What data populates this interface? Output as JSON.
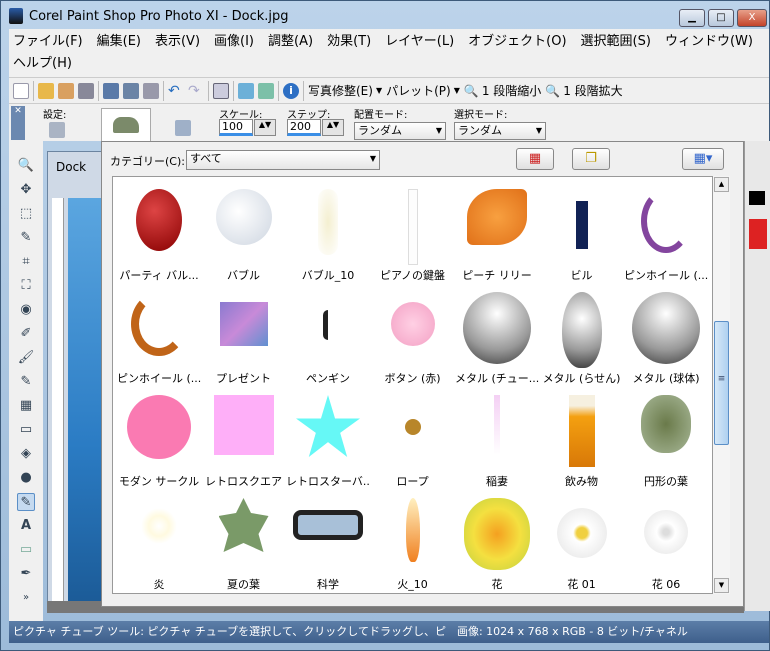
{
  "window": {
    "title": "Corel Paint Shop Pro Photo XI - Dock.jpg",
    "minimize": "▁",
    "maximize": "□",
    "close": "X"
  },
  "menu": [
    "ファイル(F)",
    "編集(E)",
    "表示(V)",
    "画像(I)",
    "調整(A)",
    "効果(T)",
    "レイヤー(L)",
    "オブジェクト(O)",
    "選択範囲(S)",
    "ウィンドウ(W)",
    "ヘルプ(H)"
  ],
  "toolbar": {
    "photo_fix": "写真修整(E)",
    "palette": "パレット(P)",
    "zoom_out": "1 段階縮小",
    "zoom_in": "1 段階拡大"
  },
  "options": {
    "presets_label": "設定:",
    "scale_label": "スケール:",
    "scale_value": "100",
    "step_label": "ステップ:",
    "step_value": "200",
    "placement_label": "配置モード:",
    "placement_value": "ランダム",
    "selection_label": "選択モード:",
    "selection_value": "ランダム"
  },
  "document": {
    "tab": "Dock"
  },
  "picker": {
    "category_label": "カテゴリー(C):",
    "category_value": "すべて",
    "items": [
      "パーティ バル...",
      "バブル",
      "バブル_10",
      "ピアノの鍵盤",
      "ピーチ リリー",
      "ビル",
      "ピンホイール (...",
      "ピンホイール (...",
      "プレゼント",
      "ペンギン",
      "ボタン (赤)",
      "メタル (チュー...",
      "メタル (らせん)",
      "メタル (球体)",
      "モダン サークル",
      "レトロスクエア",
      "レトロスターバ...",
      "ロープ",
      "稲妻",
      "飲み物",
      "円形の葉",
      "炎",
      "夏の葉",
      "科学",
      "火_10",
      "花",
      "花 01",
      "花 06"
    ]
  },
  "status": {
    "text": "ピクチャ チューブ ツール: ピクチャ チューブを選択して、クリックしてドラッグし、ピ　画像:  1024 x 768 x RGB - 8 ビット/チャネル"
  }
}
